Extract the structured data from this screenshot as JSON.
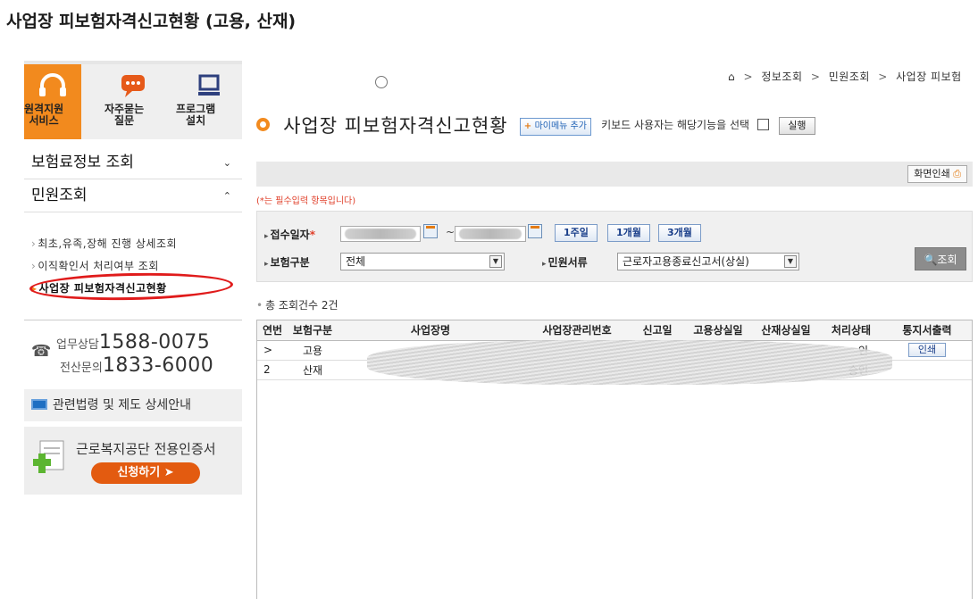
{
  "page_heading": "사업장 피보험자격신고현황 (고용, 산재)",
  "sidebar": {
    "quick_links": [
      {
        "label": "원격지원\n서비스",
        "icon": "headset-icon"
      },
      {
        "label": "자주묻는\n질문",
        "icon": "chat-bubble-icon"
      },
      {
        "label": "프로그램\n설치",
        "icon": "monitor-icon"
      }
    ],
    "menus": [
      {
        "label": "보험료정보 조회",
        "state": "collapsed"
      },
      {
        "label": "민원조회",
        "state": "expanded"
      }
    ],
    "submenu": [
      {
        "label": "최초,유족,장해 진행 상세조회"
      },
      {
        "label": "이직확인서 처리여부 조회"
      },
      {
        "label": "사업장 피보험자격신고현황"
      }
    ],
    "contact": {
      "consult_label": "업무상담",
      "consult_number": "1588-0075",
      "it_label": "전산문의",
      "it_number": "1833-6000"
    },
    "law_link": "관련법령 및 제도 상세안내",
    "cert": {
      "title": "근로복지공단 전용인증서",
      "button": "신청하기"
    }
  },
  "breadcrumb": [
    "정보조회",
    "민원조회",
    "사업장 피보험"
  ],
  "title": {
    "text": "사업장 피보험자격신고현황",
    "mymenu_button": "마이메뉴 추가",
    "keyboard_note": "키보드 사용자는 해당기능을 선택",
    "run_button": "실행"
  },
  "print_button": "화면인쇄",
  "required_note": "(*는 필수입력 항목입니다)",
  "search": {
    "receipt_date_label": "접수일자",
    "insurance_type_label": "보험구분",
    "insurance_type_value": "전체",
    "document_label": "민원서류",
    "document_value": "근로자고용종료신고서(상실)",
    "period_buttons": [
      "1주일",
      "1개월",
      "3개월"
    ],
    "search_button": "조회"
  },
  "total_count": "총 조회건수 2건",
  "table": {
    "headers": [
      "연번",
      "보험구분",
      "사업장명",
      "사업장관리번호",
      "신고일",
      "고용상실일",
      "산재상실일",
      "처리상태",
      "통지서출력"
    ],
    "rows": [
      {
        "no": ">",
        "type": "고용",
        "status": "인",
        "print": "인쇄"
      },
      {
        "no": "2",
        "type": "산재",
        "status": "승인",
        "print": ""
      }
    ]
  },
  "colors": {
    "accent": "#f28a1e",
    "link_blue": "#1a3f8a",
    "annotation_red": "#e01b1b"
  }
}
